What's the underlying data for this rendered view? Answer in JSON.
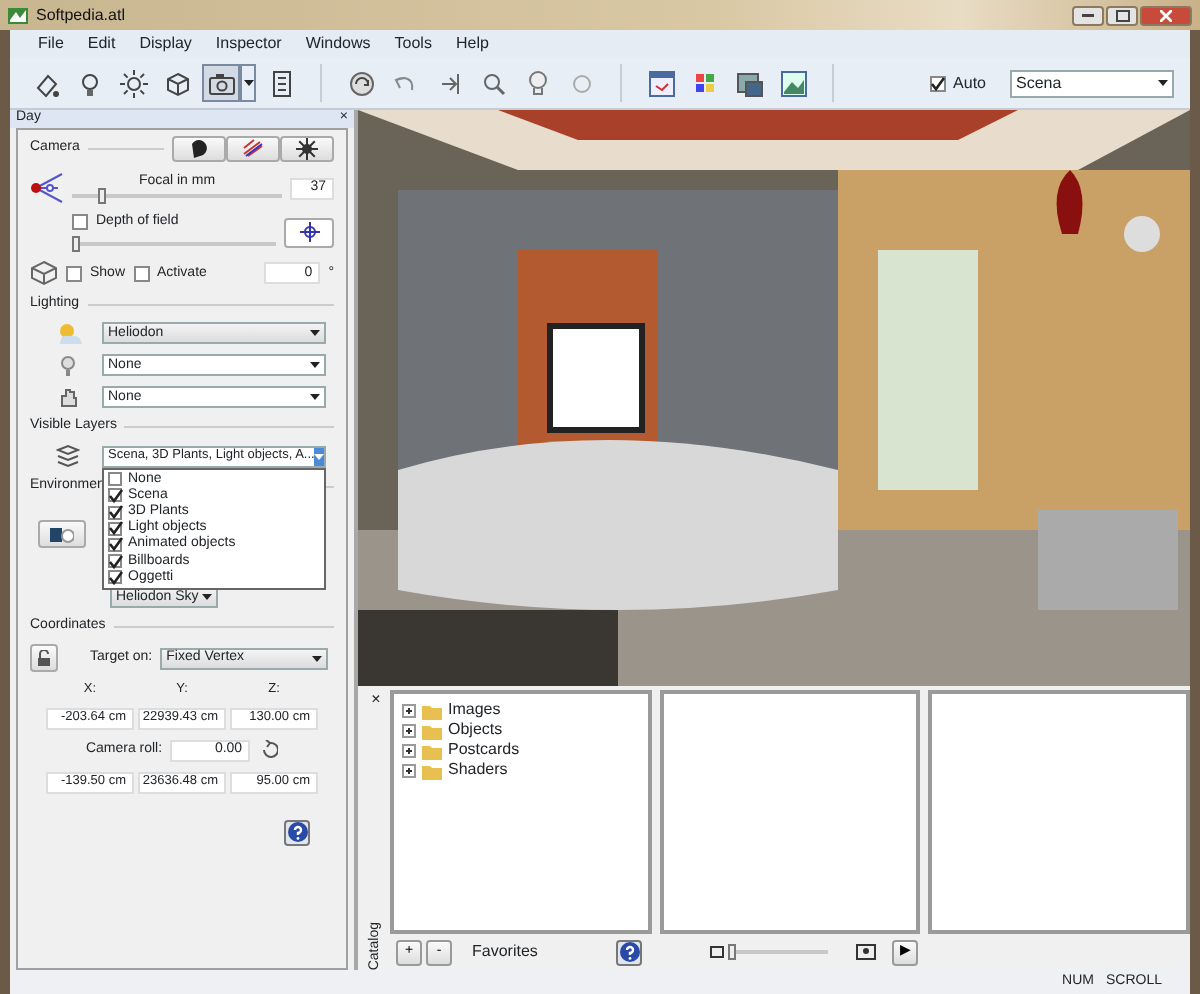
{
  "window": {
    "title": "Softpedia.atl"
  },
  "menu": [
    "File",
    "Edit",
    "Display",
    "Inspector",
    "Windows",
    "Tools",
    "Help"
  ],
  "toolbar": {
    "groups": [
      [
        {
          "kind": "button",
          "selected": false
        },
        {
          "kind": "button",
          "selected": false
        },
        {
          "kind": "button",
          "selected": false
        },
        {
          "kind": "button",
          "selected": false
        },
        {
          "kind": "split",
          "selected": true
        },
        {
          "kind": "button",
          "selected": false
        }
      ],
      [
        {
          "kind": "button",
          "selected": false
        },
        {
          "kind": "button",
          "selected": false
        },
        {
          "kind": "button",
          "selected": false
        },
        {
          "kind": "button",
          "selected": false
        },
        {
          "kind": "button",
          "selected": false
        },
        {
          "kind": "button",
          "selected": false
        }
      ],
      [
        {
          "kind": "button",
          "selected": false
        },
        {
          "kind": "button",
          "selected": false
        },
        {
          "kind": "button",
          "selected": false
        },
        {
          "kind": "button",
          "selected": false
        }
      ]
    ],
    "auto": {
      "label": "Auto",
      "checked": true
    },
    "scene": "Scena"
  },
  "panel": {
    "title": "Day",
    "close": "×",
    "camera": {
      "heading": "Camera",
      "focal": {
        "label": "Focal in mm",
        "level": 0.12,
        "value": "37"
      },
      "depth_of_field": {
        "label": "Depth of field",
        "checked": false,
        "level": 0
      },
      "show": {
        "label": "Show",
        "checked": false
      },
      "activate": {
        "label": "Activate",
        "checked": false
      },
      "angle": {
        "value": "0",
        "unit": "°"
      }
    },
    "lighting": {
      "heading": "Lighting",
      "selects": [
        "Heliodon",
        "None",
        "None"
      ]
    },
    "visible_layers": {
      "heading": "Visible Layers",
      "value": "Scena, 3D Plants, Light objects, A...",
      "expanded": true,
      "options": [
        {
          "label": "None",
          "checked": false
        },
        {
          "label": "Scena",
          "checked": true
        },
        {
          "label": "3D Plants",
          "checked": true
        },
        {
          "label": "Light objects",
          "checked": true
        },
        {
          "label": "Animated objects",
          "checked": true
        },
        {
          "label": "Billboards",
          "checked": true
        },
        {
          "label": "Oggetti",
          "checked": true
        }
      ]
    },
    "environment": {
      "heading": "Environmen",
      "sky": "Heliodon Sky"
    },
    "coordinates": {
      "heading": "Coordinates",
      "target_label": "Target on:",
      "target": "Fixed Vertex",
      "axes": [
        "X:",
        "Y:",
        "Z:"
      ],
      "position": [
        "-203.64 cm",
        "22939.43 cm",
        "130.00 cm"
      ],
      "roll_label": "Camera roll:",
      "roll": "0.00",
      "target_position": [
        "-139.50 cm",
        "23636.48 cm",
        "95.00 cm"
      ]
    }
  },
  "catalog": {
    "label": "Catalog",
    "close": "×",
    "tree": [
      {
        "label": "Images",
        "expanded": false
      },
      {
        "label": "Objects",
        "expanded": false
      },
      {
        "label": "Postcards",
        "expanded": false
      },
      {
        "label": "Shaders",
        "expanded": false
      }
    ],
    "add": "+",
    "remove": "-",
    "favorites": "Favorites",
    "play": "▶"
  },
  "status_bar": [
    "NUM",
    "SCROLL"
  ]
}
